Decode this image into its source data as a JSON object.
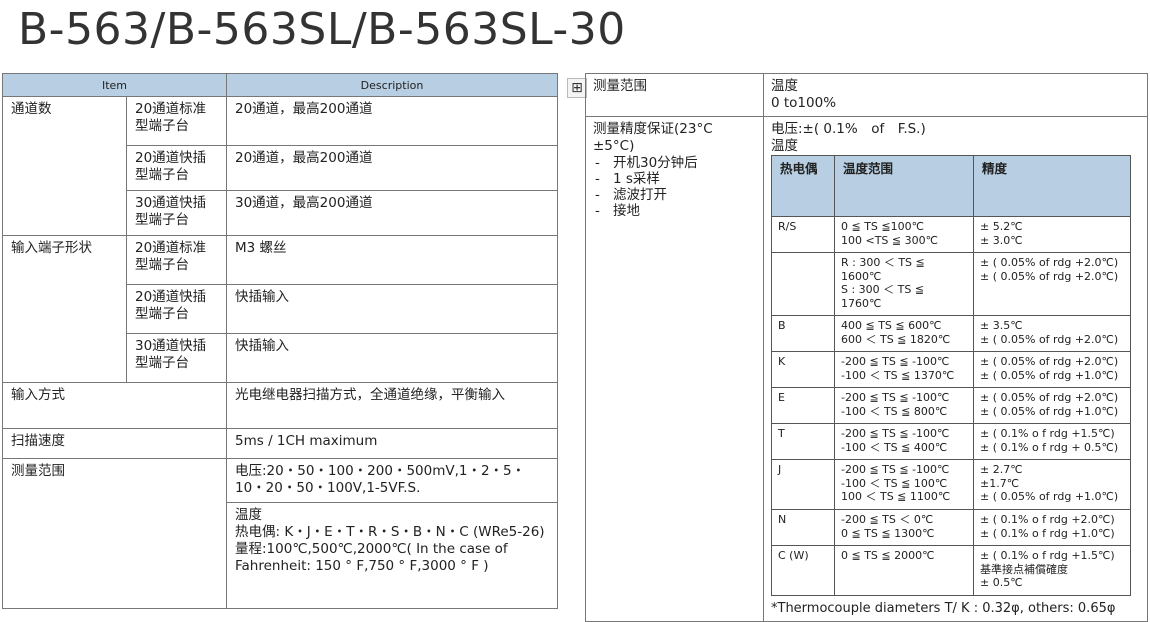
{
  "title": "B-563/B-563SL/B-563SL-30",
  "left": {
    "header_item": "Item",
    "header_desc": "Description",
    "ch_label": "通道数",
    "ch_rows": [
      {
        "type": "20通道标准\n型端子台",
        "desc": "20通道，最高200通道"
      },
      {
        "type": "20通道快插\n型端子台",
        "desc": "20通道，最高200通道"
      },
      {
        "type": "30通道快插\n型端子台",
        "desc": "30通道，最高200通道"
      }
    ],
    "term_label": "输入端子形状",
    "term_rows": [
      {
        "type": "20通道标准\n型端子台",
        "desc": "M3 螺丝"
      },
      {
        "type": "20通道快插\n型端子台",
        "desc": "快插输入"
      },
      {
        "type": "30通道快插\n型端子台",
        "desc": "快插输入"
      }
    ],
    "input_method_label": "输入方式",
    "input_method_value": "光电继电器扫描方式，全通道绝缘，平衡输入",
    "scan_label": "扫描速度",
    "scan_value": "5ms / 1CH maximum",
    "range_label": "测量范围",
    "range_voltage": "电压:20・50・100・200・500mV,1・2・5・10・20・50・100V,1-5VF.S.",
    "range_temp": "温度\n热电偶: K・J・E・T・R・S・B・N・C (WRe5-26)\n量程:100℃,500℃,2000℃( In the case of Fahrenheit: 150 ° F,750 ° F,3000 ° F )"
  },
  "right": {
    "range_label": "测量范围",
    "range_value": "温度\n0 to100%",
    "acc_label": "测量精度保证(23°C ±5°C)",
    "acc_bullets": [
      "开机30分钟后",
      "1 s采样",
      "滤波打开",
      "接地"
    ],
    "voltage_line": "电压:±( 0.1%　of　F.S.)",
    "temp_label": "温度",
    "tc_headers": [
      "热电偶",
      "温度范围",
      "精度"
    ],
    "tc_rows": [
      {
        "tc": "R/S",
        "range": "0 ≦ TS ≦100℃\n100 <TS ≦ 300℃",
        "acc": "± 5.2℃\n± 3.0℃"
      },
      {
        "tc": "",
        "range": "R : 300 ＜ TS ≦ 1600℃\nS : 300 ＜ TS ≦ 1760℃",
        "acc": "± ( 0.05% of rdg +2.0℃)\n± ( 0.05% of rdg +2.0℃)"
      },
      {
        "tc": "B",
        "range": "400 ≦  TS ≦ 600℃\n600 ＜ TS ≦ 1820℃",
        "acc": "± 3.5℃\n± ( 0.05% of rdg +2.0℃)"
      },
      {
        "tc": "K",
        "range": "-200 ≦ TS ≦ -100℃\n-100 ＜ TS ≦ 1370℃",
        "acc": "± ( 0.05% of rdg +2.0℃)\n± ( 0.05% of rdg +1.0℃)"
      },
      {
        "tc": "E",
        "range": "-200 ≦ TS ≦ -100℃\n-100 ＜ TS ≦ 800℃",
        "acc": "± ( 0.05% of rdg +2.0℃)\n± ( 0.05% of rdg +1.0℃)"
      },
      {
        "tc": "T",
        "range": "-200 ≦ TS ≦ -100℃\n-100 ＜ TS ≦ 400℃",
        "acc": "± ( 0.1% o f rdg +1.5℃)\n± ( 0.1% o f rdg + 0.5℃)"
      },
      {
        "tc": "J",
        "range": "-200 ≦ TS ≦ -100℃\n-100 ＜ TS ≦ 100℃\n100 ＜ TS ≦ 1100℃",
        "acc": "± 2.7℃\n±1.7℃\n± ( 0.05% of rdg +1.0℃)"
      },
      {
        "tc": "N",
        "range": "-200 ≦ TS ＜ 0℃\n0 ≦  TS ≦ 1300℃",
        "acc": "± ( 0.1% o f rdg +2.0℃)\n± ( 0.1% o f rdg +1.0℃)"
      },
      {
        "tc": "C (W)",
        "range": "0 ≦ TS ≦ 2000℃",
        "acc": "± ( 0.1% o f rdg +1.5℃)\n基準接点補償確度\n± 0.5℃"
      }
    ],
    "note": "*Thermocouple diameters T/ K : 0.32φ, others: 0.65φ"
  },
  "icons": {
    "expand": "expand-icon"
  }
}
